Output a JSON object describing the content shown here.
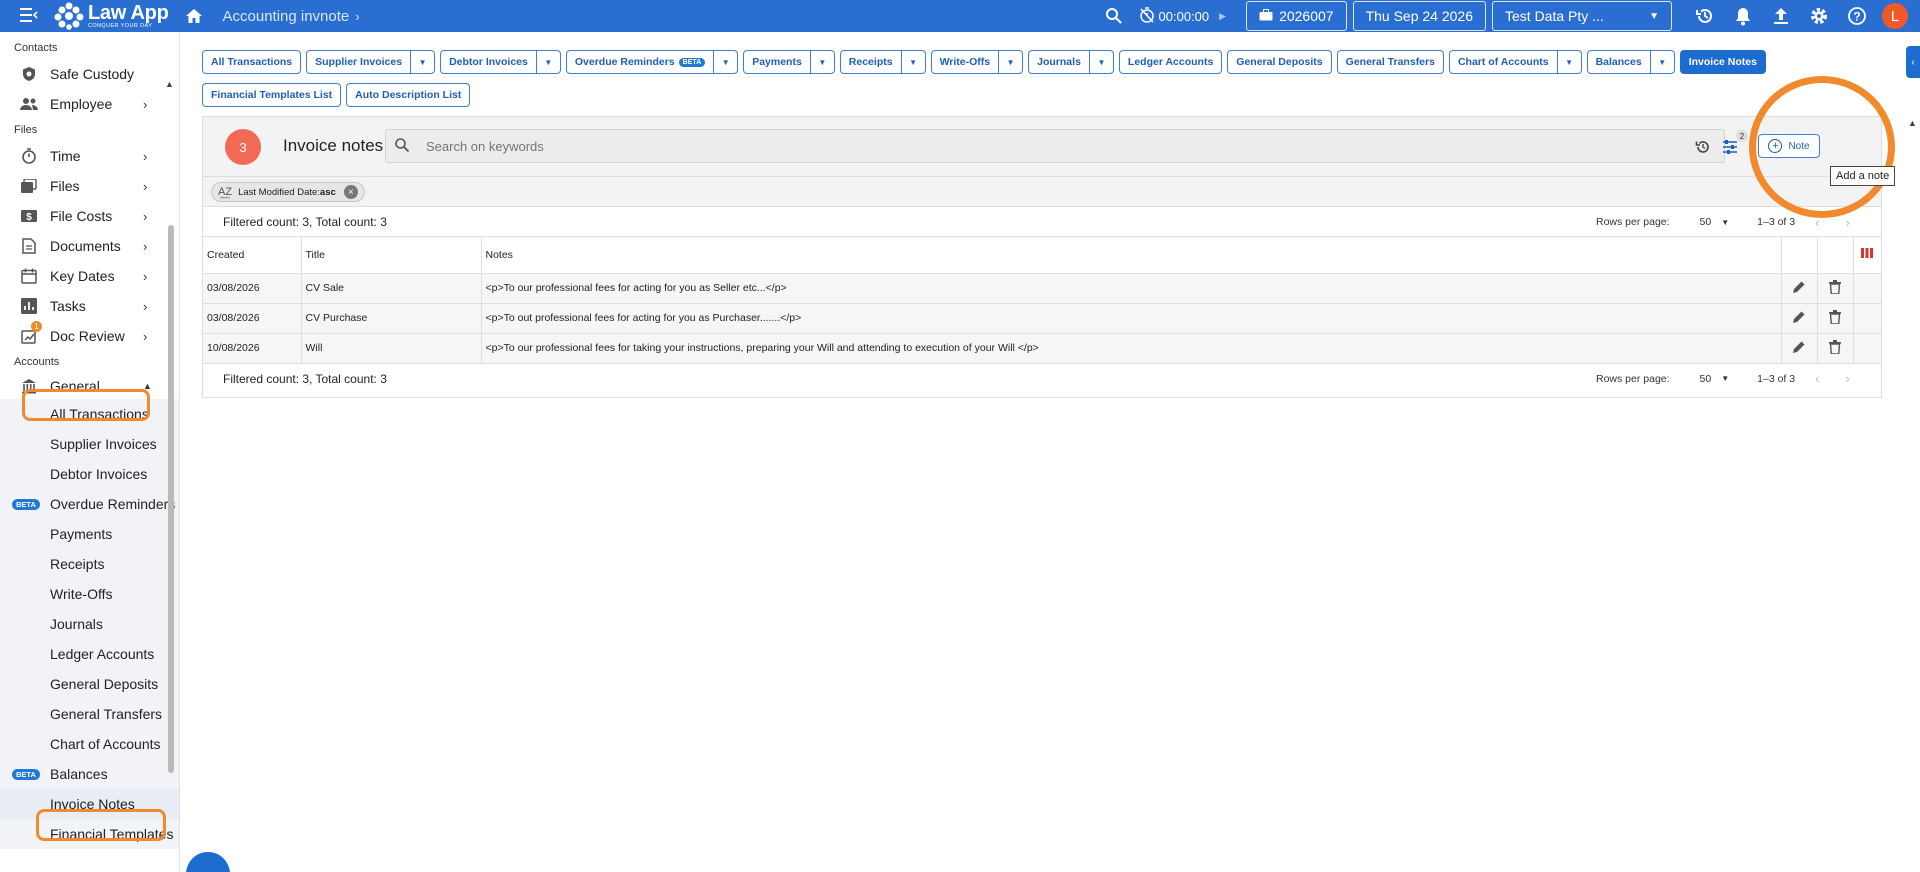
{
  "topbar": {
    "logo_name": "Law App",
    "logo_tagline": "CONQUER YOUR DAY",
    "breadcrumb": "Accounting invnote",
    "timer": "00:00:00",
    "file_number": "2026007",
    "date": "Thu Sep 24 2026",
    "company": "Test Data Pty ...",
    "avatar_initial": "L",
    "accent": "#2a6ed2"
  },
  "sidebar": {
    "sections": {
      "contacts": "Contacts",
      "files": "Files",
      "accounts": "Accounts"
    },
    "contacts_items": [
      {
        "label": "Safe Custody",
        "icon": "safe-icon"
      },
      {
        "label": "Employee",
        "icon": "people-icon"
      }
    ],
    "files_items": [
      {
        "label": "Time",
        "icon": "stopwatch-icon"
      },
      {
        "label": "Files",
        "icon": "files-icon"
      },
      {
        "label": "File Costs",
        "icon": "cost-icon"
      },
      {
        "label": "Documents",
        "icon": "document-icon"
      },
      {
        "label": "Key Dates",
        "icon": "calendar-icon"
      },
      {
        "label": "Tasks",
        "icon": "chart-icon"
      },
      {
        "label": "Doc Review",
        "icon": "review-icon",
        "badge": "1"
      }
    ],
    "general_label": "General",
    "general_subitems": [
      {
        "label": "All Transactions"
      },
      {
        "label": "Supplier Invoices"
      },
      {
        "label": "Debtor Invoices"
      },
      {
        "label": "Overdue Reminders",
        "beta": "BETA"
      },
      {
        "label": "Payments"
      },
      {
        "label": "Receipts"
      },
      {
        "label": "Write-Offs"
      },
      {
        "label": "Journals"
      },
      {
        "label": "Ledger Accounts"
      },
      {
        "label": "General Deposits"
      },
      {
        "label": "General Transfers"
      },
      {
        "label": "Chart of Accounts"
      },
      {
        "label": "Balances",
        "beta": "BETA"
      },
      {
        "label": "Invoice Notes"
      },
      {
        "label": "Financial Templates"
      }
    ]
  },
  "tabs": [
    {
      "label": "All Transactions",
      "dropdown": false
    },
    {
      "label": "Supplier Invoices",
      "dropdown": true
    },
    {
      "label": "Debtor Invoices",
      "dropdown": true
    },
    {
      "label": "Overdue Reminders",
      "dropdown": true,
      "beta": "BETA"
    },
    {
      "label": "Payments",
      "dropdown": true
    },
    {
      "label": "Receipts",
      "dropdown": true
    },
    {
      "label": "Write-Offs",
      "dropdown": true
    },
    {
      "label": "Journals",
      "dropdown": true
    },
    {
      "label": "Ledger Accounts",
      "dropdown": false
    },
    {
      "label": "General Deposits",
      "dropdown": false
    },
    {
      "label": "General Transfers",
      "dropdown": false
    },
    {
      "label": "Chart of Accounts",
      "dropdown": true
    },
    {
      "label": "Balances",
      "dropdown": true
    },
    {
      "label": "Invoice Notes",
      "dropdown": false,
      "active": true
    },
    {
      "label": "Financial Templates List",
      "dropdown": false
    },
    {
      "label": "Auto Description List",
      "dropdown": false
    }
  ],
  "panel": {
    "count_badge": "3",
    "title": "Invoice notes",
    "search_placeholder": "Search on keywords",
    "filter_count": "2",
    "note_button": "Note",
    "tooltip": "Add a note",
    "sort_chip_prefix": "Last Modified Date:",
    "sort_chip_value": "asc",
    "count_text": "Filtered count: 3, Total count: 3",
    "rows_per_page_label": "Rows per page:",
    "rows_per_page": "50",
    "range": "1–3 of 3",
    "columns": [
      "Created",
      "Title",
      "Notes"
    ],
    "rows": [
      {
        "created": "03/08/2026",
        "title": "CV Sale",
        "notes": "<p>To our professional fees for acting for you as Seller etc...</p>"
      },
      {
        "created": "03/08/2026",
        "title": "CV Purchase",
        "notes": "<p>To out professional fees for acting for you as Purchaser.......</p>"
      },
      {
        "created": "10/08/2026",
        "title": "Will",
        "notes": "<p>To our professional fees for taking your instructions, preparing your Will and attending to execution of your Will   </p>"
      }
    ]
  }
}
